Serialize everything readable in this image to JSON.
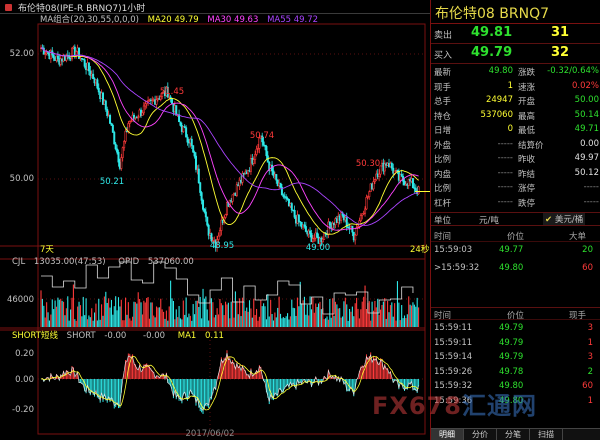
{
  "window": {
    "title": "布伦特08(IPE-R BRNQ7)1小时"
  },
  "main_chart": {
    "legend": {
      "ma_combo": "MA组合(20,30,55,0,0,0)",
      "ma20": "MA20 49.79",
      "ma30": "MA30 49.63",
      "ma55": "MA55 49.72"
    },
    "price_axis": [
      "52.00",
      "50.00"
    ],
    "annotations": [
      "51.45",
      "50.21",
      "50.74",
      "48.95",
      "49.00",
      "50.30"
    ],
    "left_tag": "7天",
    "right_tag": "24秒",
    "colors": {
      "ma20": "#ffff33",
      "ma30": "#ff44ff",
      "ma55": "#aa44ff",
      "up": "#ff3a3a",
      "down": "#2ee8e8"
    }
  },
  "volume_chart": {
    "legend": {
      "name": "CJL",
      "cjl": "13035.00(47:53)",
      "opid": "OPID",
      "opid_value": "537060.00"
    },
    "axis_label": "46000"
  },
  "short_chart": {
    "legend": {
      "name": "SHORT短线",
      "short": "SHORT",
      "short_value": "-0.00",
      "mid": "-0.00",
      "ma1": "MA1",
      "ma1_value": "0.11"
    },
    "axis": [
      "0.20",
      "0.00",
      "-0.20"
    ],
    "date_label": "2017/06/02"
  },
  "panel": {
    "title": "布伦特08  BRNQ7",
    "sell": {
      "label": "卖出",
      "price": "49.81",
      "qty": "31"
    },
    "buy": {
      "label": "买入",
      "price": "49.79",
      "qty": "32"
    },
    "stats": [
      {
        "l": "最新",
        "v": "49.80",
        "c": "green",
        "l2": "涨跌",
        "v2": "-0.32/0.64%",
        "c2": "green"
      },
      {
        "l": "现手",
        "v": "1",
        "c": "yellow",
        "l2": "速涨",
        "v2": "0.02%",
        "c2": "red"
      },
      {
        "l": "总手",
        "v": "24947",
        "c": "yellow",
        "l2": "开盘",
        "v2": "50.00",
        "c2": "green"
      },
      {
        "l": "持仓",
        "v": "537060",
        "c": "yellow",
        "l2": "最高",
        "v2": "50.14",
        "c2": "green"
      },
      {
        "l": "日增",
        "v": "0",
        "c": "yellow",
        "l2": "最低",
        "v2": "49.71",
        "c2": "green"
      },
      {
        "l": "外盘",
        "v": "-----",
        "c": "gray",
        "l2": "结算价",
        "v2": "0.00",
        "c2": "white"
      },
      {
        "l": "比例",
        "v": "-----",
        "c": "gray",
        "l2": "昨收",
        "v2": "49.97",
        "c2": "white"
      },
      {
        "l": "内盘",
        "v": "-----",
        "c": "gray",
        "l2": "昨结",
        "v2": "50.12",
        "c2": "white"
      },
      {
        "l": "比例",
        "v": "-----",
        "c": "gray",
        "l2": "涨停",
        "v2": "-----",
        "c2": "gray"
      },
      {
        "l": "杠杆",
        "v": "-----",
        "c": "gray",
        "l2": "跌停",
        "v2": "-----",
        "c2": "gray"
      }
    ],
    "unit": {
      "label": "单位",
      "yuan": "元/吨",
      "check": "✔",
      "usd": "美元/桶"
    },
    "ticks_header": {
      "time": "时间",
      "price": "价位",
      "qty": "大单"
    },
    "big_ticks": [
      {
        "time": "15:59:03",
        "price": "49.77",
        "qty": "20",
        "pc": "green",
        "qc": "green",
        "mark": ""
      },
      {
        "time": "15:59:32",
        "price": "49.80",
        "qty": "60",
        "pc": "green",
        "qc": "red",
        "mark": ">"
      }
    ],
    "trades_header": {
      "time": "时间",
      "price": "价位",
      "qty": "现手"
    },
    "trades": [
      {
        "time": "15:59:11",
        "price": "49.79",
        "qty": "3",
        "pc": "green",
        "qc": "red"
      },
      {
        "time": "15:59:11",
        "price": "49.79",
        "qty": "1",
        "pc": "green",
        "qc": "red"
      },
      {
        "time": "15:59:14",
        "price": "49.79",
        "qty": "3",
        "pc": "green",
        "qc": "red"
      },
      {
        "time": "15:59:26",
        "price": "49.78",
        "qty": "2",
        "pc": "green",
        "qc": "green"
      },
      {
        "time": "15:59:32",
        "price": "49.80",
        "qty": "60",
        "pc": "green",
        "qc": "red"
      },
      {
        "time": "15:59:36",
        "price": "49.80",
        "qty": "1",
        "pc": "green",
        "qc": "red"
      }
    ],
    "tabs": [
      "明细",
      "分价",
      "分笔",
      "扫描"
    ]
  },
  "watermark": {
    "text1": "FX678",
    "text2": "汇通网"
  }
}
